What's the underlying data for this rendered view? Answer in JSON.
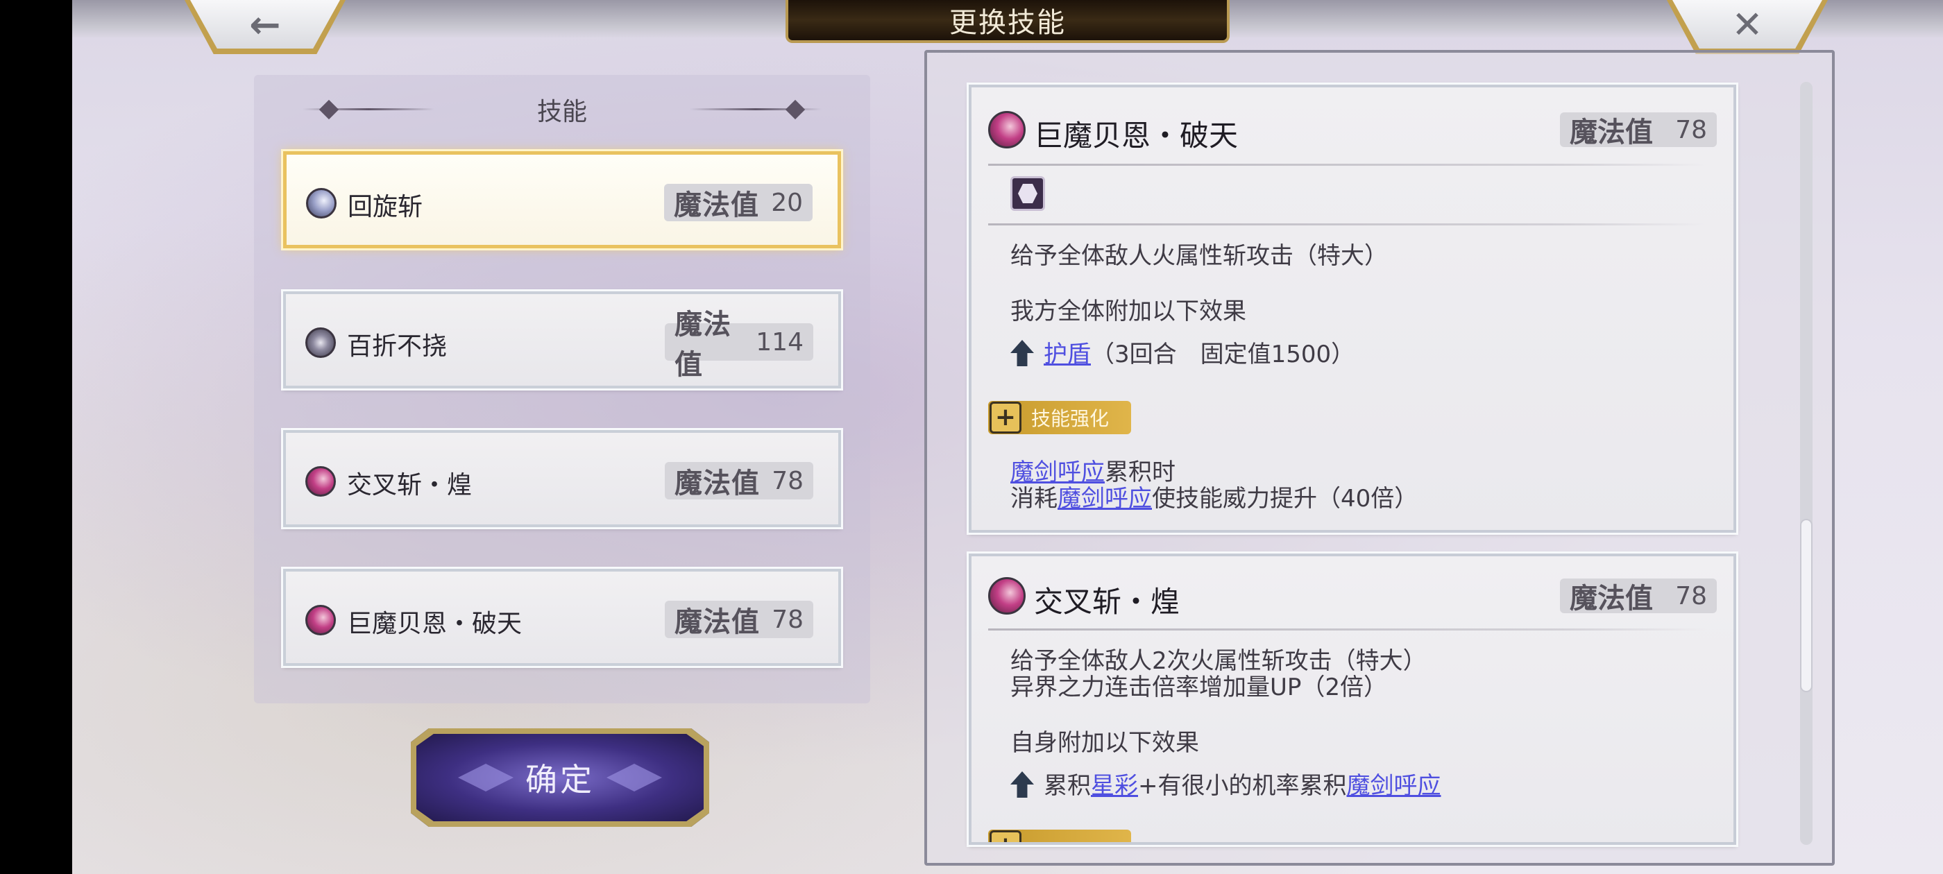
{
  "header": {
    "title": "更换技能",
    "back_icon": "←",
    "close_icon": "✕"
  },
  "skill_list": {
    "heading": "技能",
    "mp_label": "魔法值",
    "items": [
      {
        "name": "回旋斩",
        "mp": "20",
        "icon": "crescent-moon-icon",
        "selected": true
      },
      {
        "name": "百折不挠",
        "mp": "114",
        "icon": "compass-star-icon",
        "selected": false
      },
      {
        "name": "交叉斩・煌",
        "mp": "78",
        "icon": "crescent-moon-pink-icon",
        "selected": false
      },
      {
        "name": "巨魔贝恩・破天",
        "mp": "78",
        "icon": "crescent-moon-pink-icon",
        "selected": false
      }
    ]
  },
  "confirm_label": "确定",
  "details": [
    {
      "name": "巨魔贝恩・破天",
      "mp_label": "魔法值",
      "mp": "78",
      "lines": {
        "l1": "给予全体敌人火属性斩攻击（特大）",
        "l2": "我方全体附加以下效果",
        "buff_link": "护盾",
        "buff_rest": "（3回合　固定值1500）",
        "enh_label": "技能强化",
        "e1_link": "魔剑呼应",
        "e1_rest": "累积时",
        "e2_pre": "消耗",
        "e2_link": "魔剑呼应",
        "e2_rest": "使技能威力提升（40倍）"
      }
    },
    {
      "name": "交叉斩・煌",
      "mp_label": "魔法值",
      "mp": "78",
      "lines": {
        "l1": "给予全体敌人2次火属性斩攻击（特大）",
        "l2": "异界之力连击倍率增加量UP（2倍）",
        "l3": "自身附加以下效果",
        "b_pre": "累积",
        "b_link1": "星彩",
        "b_mid": "+有很小的机率累积",
        "b_link2": "魔剑呼应"
      }
    }
  ],
  "colors": {
    "selected_border": "#e9c25f",
    "link": "#4f4fe0",
    "enhance_tag": "#d8ab3d",
    "confirm_button": "#3e2f82"
  }
}
